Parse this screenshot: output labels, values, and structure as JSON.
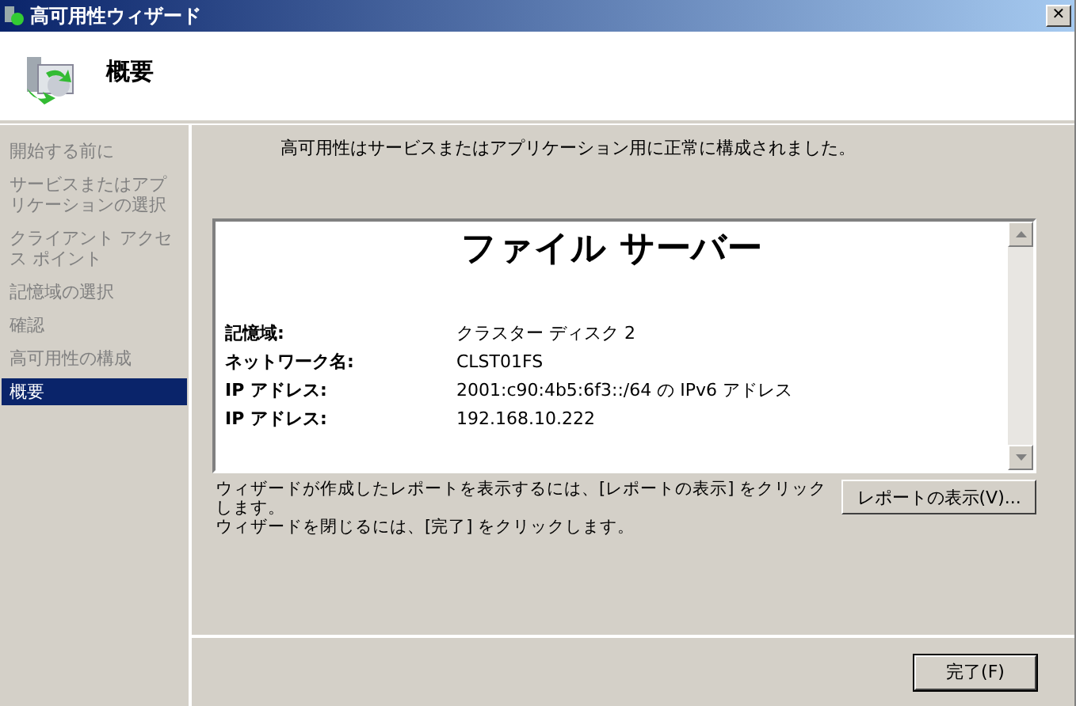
{
  "window": {
    "title": "高可用性ウィザード",
    "close_button": "✕"
  },
  "header": {
    "title": "概要"
  },
  "steps": [
    {
      "label": "開始する前に",
      "selected": false
    },
    {
      "label": "サービスまたはアプリケーションの選択",
      "selected": false
    },
    {
      "label": "クライアント アクセス ポイント",
      "selected": false
    },
    {
      "label": "記憶域の選択",
      "selected": false
    },
    {
      "label": "確認",
      "selected": false
    },
    {
      "label": "高可用性の構成",
      "selected": false
    },
    {
      "label": "概要",
      "selected": true
    }
  ],
  "message": "高可用性はサービスまたはアプリケーション用に正常に構成されました。",
  "report": {
    "title": "ファイル サーバー",
    "rows": [
      {
        "label": "記憶域:",
        "value": "クラスター ディスク 2"
      },
      {
        "label": "ネットワーク名:",
        "value": "CLST01FS"
      },
      {
        "label": "IP アドレス:",
        "value": "2001:c90:4b5:6f3::/64 の IPv6 アドレス"
      },
      {
        "label": "IP アドレス:",
        "value": "192.168.10.222"
      }
    ]
  },
  "hint_lines": [
    "ウィザードが作成したレポートを表示するには、[レポートの表示] をクリックします。",
    "ウィザードを閉じるには、[完了] をクリックします。"
  ],
  "view_report_button": "レポートの表示(V)...",
  "finish_button": "完了(F)"
}
